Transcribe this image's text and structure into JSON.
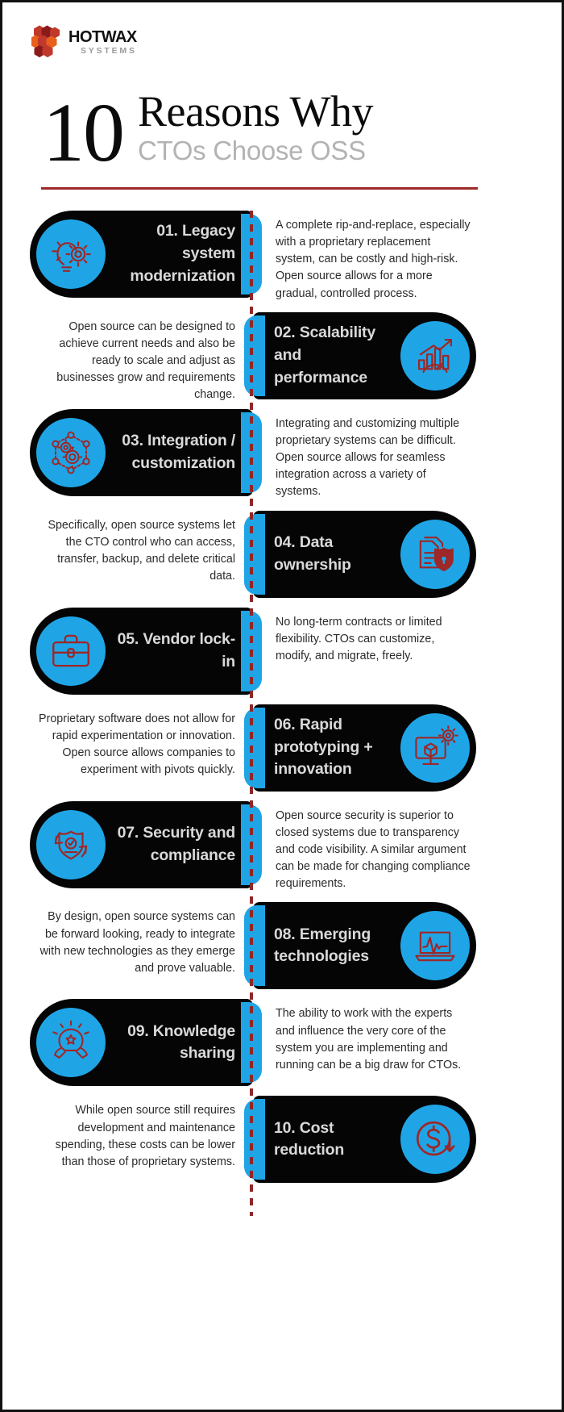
{
  "brand": {
    "name": "HOTWAX",
    "subtitle": "SYSTEMS",
    "logo_icon": "honeycomb-hexagons-icon",
    "colors": {
      "hex_dark_red": "#8B1A1A",
      "hex_red": "#C0392B",
      "hex_orange": "#E8601C"
    }
  },
  "header": {
    "number": "10",
    "title": "Reasons Why",
    "subtitle": "CTOs Choose OSS",
    "divider_color": "#9E2A2A"
  },
  "theme": {
    "accent_blue": "#1FA5E6",
    "pill_black": "#050505",
    "label_gray": "#D9D9D9",
    "body_text": "#2B2B2B",
    "spine_red": "#8F2727",
    "page_background": "#FFFFFF"
  },
  "items": [
    {
      "number": "01.",
      "title": "01. Legacy system modernization",
      "description": "A complete rip-and-replace, especially with a proprietary replacement system, can be costly and high-risk. Open source allows for a more gradual, controlled process.",
      "icon": "lightbulb-gear-icon",
      "pill_side": "left"
    },
    {
      "number": "02.",
      "title": "02. Scalability and performance",
      "description": "Open source can be designed to achieve current needs and also be ready to scale and adjust as businesses grow and requirements change.",
      "icon": "bar-chart-growth-icon",
      "pill_side": "right"
    },
    {
      "number": "03.",
      "title": "03. Integration / customization",
      "description": "Integrating and customizing multiple proprietary systems can be difficult. Open source allows for seamless integration across a variety of systems.",
      "icon": "network-gears-icon",
      "pill_side": "left"
    },
    {
      "number": "04.",
      "title": "04. Data ownership",
      "description": "Specifically, open source systems let the CTO control who can access, transfer, backup, and delete critical data.",
      "icon": "documents-shield-lock-icon",
      "pill_side": "right"
    },
    {
      "number": "05.",
      "title": "05.   Vendor lock-in",
      "description": "No long-term contracts or limited flexibility. CTOs can customize, modify, and migrate, freely.",
      "icon": "briefcase-icon",
      "pill_side": "left"
    },
    {
      "number": "06.",
      "title": "06. Rapid prototyping + innovation",
      "description": "Proprietary software does not allow for rapid experimentation or innovation. Open source allows companies to experiment with pivots quickly.",
      "icon": "monitor-cube-gear-icon",
      "pill_side": "right"
    },
    {
      "number": "07.",
      "title": "07. Security and compliance",
      "description": "Open source security is superior to closed systems due to transparency and code visibility. A similar argument can be made for changing compliance requirements.",
      "icon": "shield-check-cycle-icon",
      "pill_side": "left"
    },
    {
      "number": "08.",
      "title": "08. Emerging technologies",
      "description": "By design, open source systems can be forward looking, ready to integrate with new technologies as they emerge and prove valuable.",
      "icon": "laptop-pulse-icon",
      "pill_side": "right"
    },
    {
      "number": "09.",
      "title": "09. Knowledge sharing",
      "description": "The ability to work with the experts and influence the very core of the system you are implementing and running can be a big draw for CTOs.",
      "icon": "brain-hands-sharing-icon",
      "pill_side": "left"
    },
    {
      "number": "10.",
      "title": "10. Cost reduction",
      "description": "While open source still requires development and maintenance spending, these costs can be lower than those of proprietary systems.",
      "icon": "dollar-coin-arrow-icon",
      "pill_side": "right"
    }
  ]
}
